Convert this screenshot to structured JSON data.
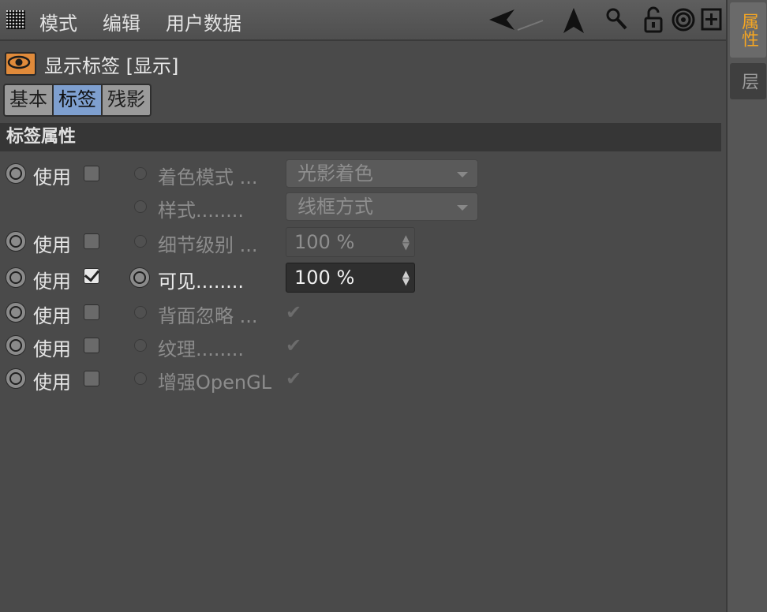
{
  "menu": {
    "items": [
      "模式",
      "编辑",
      "用户数据"
    ]
  },
  "toolbar": {
    "icons": [
      "back-arrow-icon",
      "up-arrow-icon",
      "search-icon",
      "lock-open-icon",
      "target-icon",
      "new-panel-icon"
    ]
  },
  "side_tabs": {
    "active": "属性",
    "inactive": "层"
  },
  "header": {
    "title": "显示标签 [显示]",
    "icon": "eye-icon"
  },
  "tabs": [
    "基本",
    "标签",
    "残影"
  ],
  "section": {
    "title": "标签属性"
  },
  "use_label": "使用",
  "rows": [
    {
      "label": "着色模式 ...",
      "control": "dropdown",
      "value": "光影着色"
    },
    {
      "label": "样式........",
      "control": "dropdown",
      "value": "线框方式"
    },
    {
      "label": "细节级别 ...",
      "control": "number",
      "value": "100 %"
    },
    {
      "label": "可见........",
      "control": "number",
      "value": "100 %"
    },
    {
      "label": "背面忽略 ...",
      "control": "checkbox",
      "value": "✔"
    },
    {
      "label": "纹理........",
      "control": "checkbox",
      "value": "✔"
    },
    {
      "label": "增强OpenGL",
      "control": "checkbox",
      "value": "✔"
    }
  ],
  "colors": {
    "accent": "#f5a623",
    "active_tab": "#7e9fcf",
    "panel": "#4a4a4a"
  }
}
